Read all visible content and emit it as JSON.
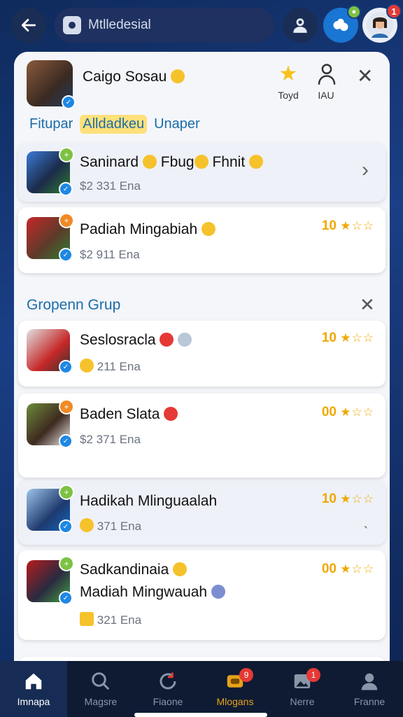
{
  "topbar": {
    "search_text": "Mtlledesial",
    "profile_badge": "1"
  },
  "header": {
    "name": "Caigo Sosau",
    "star_label": "Toyd",
    "person_label": "IAU"
  },
  "tabs": [
    {
      "label": "Fitupar",
      "active": false
    },
    {
      "label": "Alldadkeu",
      "active": true
    },
    {
      "label": "Unaper",
      "active": false
    }
  ],
  "friends": [
    {
      "name": "Saninard",
      "name2": "Fbug",
      "name3": "Fhnit",
      "meta": "$2 331 Ena"
    },
    {
      "name": "Padiah Mingabiah",
      "meta": "$2 911 Ena",
      "score": "10"
    }
  ],
  "group": {
    "title": "Gropenn Grup",
    "items": [
      {
        "name": "Seslosracla",
        "meta": "211 Ena",
        "score": "10"
      },
      {
        "name": "Baden Slata",
        "meta": "$2 371 Ena",
        "score": "00"
      },
      {
        "name": "Hadikah Mlinguaalah",
        "meta": "371 Ena",
        "score": "10"
      },
      {
        "name": "Sadkandinaia",
        "name_line2": "Madiah Mingwauah",
        "meta": "321 Ena",
        "score": "00"
      }
    ]
  },
  "stars": "★☆☆",
  "bottomnav": [
    {
      "label": "Imnapa",
      "icon": "home-icon",
      "active": true
    },
    {
      "label": "Magsre",
      "icon": "search-icon"
    },
    {
      "label": "Fiaone",
      "icon": "refresh-icon"
    },
    {
      "label": "Mlogans",
      "icon": "trophy-icon",
      "badge": "9"
    },
    {
      "label": "Nerre",
      "icon": "image-icon",
      "badge": "1"
    },
    {
      "label": "Franne",
      "icon": "person-icon"
    }
  ]
}
